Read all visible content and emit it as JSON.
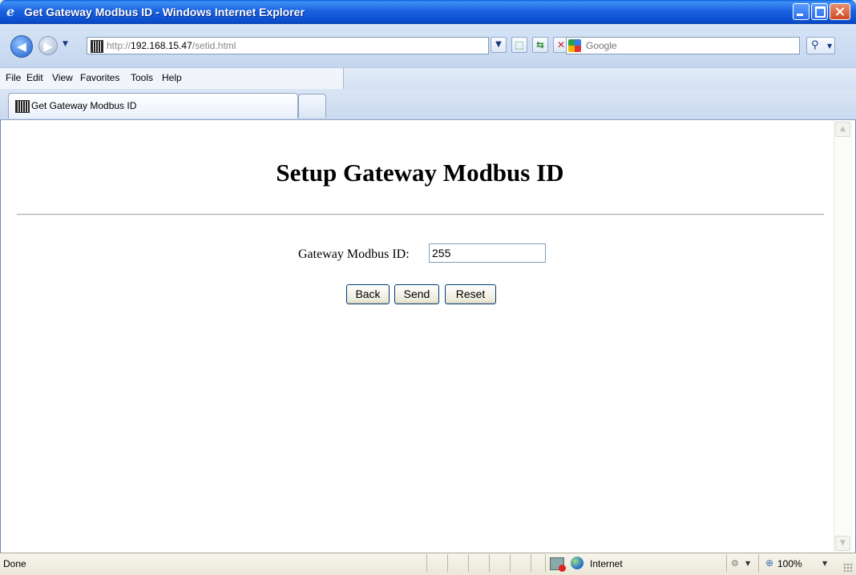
{
  "window": {
    "title": "Get Gateway Modbus ID - Windows Internet Explorer",
    "icon": "ie-logo-icon"
  },
  "navbar": {
    "address_scheme": "http://",
    "address_host": "192.168.15.47",
    "address_path": "/setid.html",
    "search_placeholder": "Google"
  },
  "menu": {
    "items": [
      "File",
      "Edit",
      "View",
      "Favorites",
      "Tools",
      "Help"
    ]
  },
  "tabs": [
    {
      "label": "Get Gateway Modbus ID",
      "active": true
    }
  ],
  "page": {
    "heading": "Setup Gateway Modbus ID",
    "field_label": "Gateway Modbus ID:",
    "field_value": "255",
    "buttons": {
      "back": "Back",
      "send": "Send",
      "reset": "Reset"
    }
  },
  "statusbar": {
    "status": "Done",
    "zone": "Internet",
    "zoom": "100%"
  },
  "colors": {
    "titlebar": "#0c4fd0",
    "close_button": "#cf4a24"
  }
}
